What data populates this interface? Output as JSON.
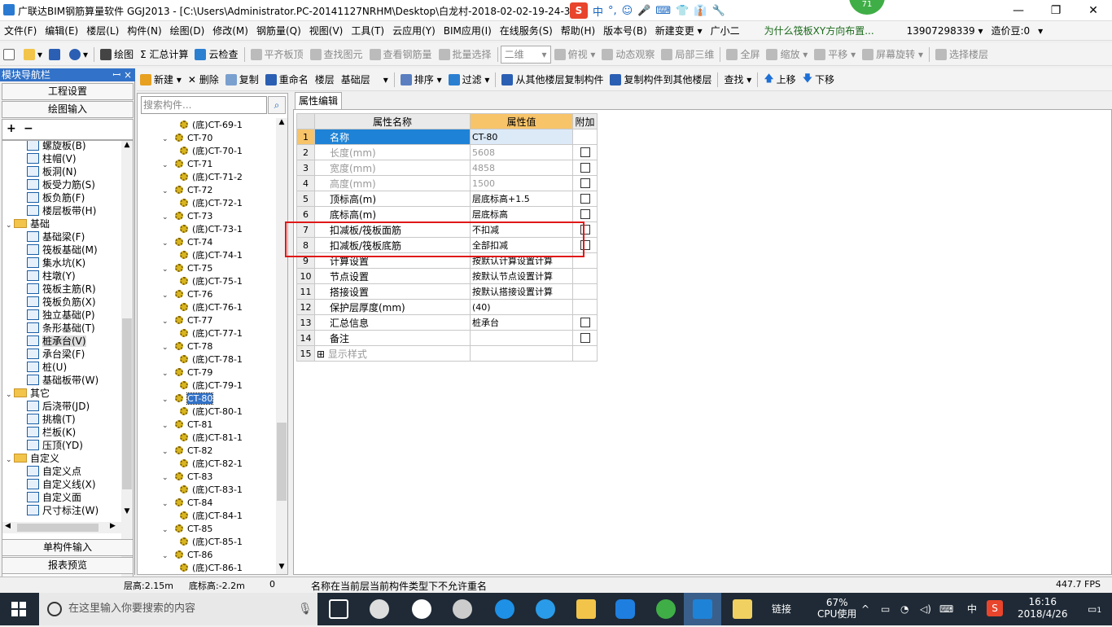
{
  "window": {
    "title": "广联达BIM钢筋算量软件 GGJ2013 - [C:\\Users\\Administrator.PC-20141127NRHM\\Desktop\\白龙村-2018-02-02-19-24-35",
    "minimize": "—",
    "restore": "❐",
    "close": "✕",
    "ime": {
      "logo": "S",
      "lang": "中",
      "items": [
        "°,",
        "☺",
        "🎤",
        "⌨",
        "👕",
        "👔",
        "🔧"
      ]
    },
    "badge": "71"
  },
  "menu": [
    "文件(F)",
    "编辑(E)",
    "楼层(L)",
    "构件(N)",
    "绘图(D)",
    "修改(M)",
    "钢筋量(Q)",
    "视图(V)",
    "工具(T)",
    "云应用(Y)",
    "BIM应用(I)",
    "在线服务(S)",
    "帮助(H)",
    "版本号(B)",
    "新建变更 ▾",
    "广小二",
    "为什么筏板XY方向布置...",
    "13907298339 ▾",
    "造价豆:0",
    "▾"
  ],
  "toolbar1": {
    "items": [
      "绘图",
      "Σ 汇总计算",
      "云检查",
      "平齐板顶",
      "查找图元",
      "查看钢筋量",
      "批量选择"
    ],
    "view_select": "二维",
    "right_items": [
      "俯视 ▾",
      "动态观察",
      "局部三维",
      "全屏",
      "缩放 ▾",
      "平移 ▾",
      "屏幕旋转 ▾",
      "选择楼层"
    ]
  },
  "toolbar2": {
    "items": [
      "新建 ▾",
      "✕ 删除",
      "复制",
      "重命名",
      "楼层",
      "基础层",
      "▾",
      "排序 ▾",
      "过滤 ▾",
      "从其他楼层复制构件",
      "复制构件到其他楼层",
      "查找 ▾",
      "上移",
      "下移"
    ]
  },
  "nav": {
    "header": "模块导航栏",
    "pin": "ꟷ ×",
    "btn_project": "工程设置",
    "btn_draw": "绘图输入",
    "tree": [
      {
        "t": "螺旋板(B)",
        "lvl": 2
      },
      {
        "t": "柱帽(V)",
        "lvl": 2
      },
      {
        "t": "板洞(N)",
        "lvl": 2
      },
      {
        "t": "板受力筋(S)",
        "lvl": 2
      },
      {
        "t": "板负筋(F)",
        "lvl": 2
      },
      {
        "t": "楼层板带(H)",
        "lvl": 2
      },
      {
        "t": "基础",
        "lvl": 1
      },
      {
        "t": "基础梁(F)",
        "lvl": 2
      },
      {
        "t": "筏板基础(M)",
        "lvl": 2
      },
      {
        "t": "集水坑(K)",
        "lvl": 2
      },
      {
        "t": "柱墩(Y)",
        "lvl": 2
      },
      {
        "t": "筏板主筋(R)",
        "lvl": 2
      },
      {
        "t": "筏板负筋(X)",
        "lvl": 2
      },
      {
        "t": "独立基础(P)",
        "lvl": 2
      },
      {
        "t": "条形基础(T)",
        "lvl": 2
      },
      {
        "t": "桩承台(V)",
        "lvl": 2,
        "sel": true
      },
      {
        "t": "承台梁(F)",
        "lvl": 2
      },
      {
        "t": "桩(U)",
        "lvl": 2
      },
      {
        "t": "基础板带(W)",
        "lvl": 2
      },
      {
        "t": "其它",
        "lvl": 1
      },
      {
        "t": "后浇带(JD)",
        "lvl": 2
      },
      {
        "t": "挑檐(T)",
        "lvl": 2
      },
      {
        "t": "栏板(K)",
        "lvl": 2
      },
      {
        "t": "压顶(YD)",
        "lvl": 2
      },
      {
        "t": "自定义",
        "lvl": 1
      },
      {
        "t": "自定义点",
        "lvl": 2
      },
      {
        "t": "自定义线(X)",
        "lvl": 2
      },
      {
        "t": "自定义面",
        "lvl": 2
      },
      {
        "t": "尺寸标注(W)",
        "lvl": 2
      }
    ],
    "btn_single": "单构件输入",
    "btn_report": "报表预览"
  },
  "comp": {
    "search_placeholder": "搜索构件...",
    "rows": [
      {
        "t": "(底)CT-69-1",
        "lvl": 2
      },
      {
        "t": "CT-70",
        "lvl": 1
      },
      {
        "t": "(底)CT-70-1",
        "lvl": 2
      },
      {
        "t": "CT-71",
        "lvl": 1
      },
      {
        "t": "(底)CT-71-2",
        "lvl": 2
      },
      {
        "t": "CT-72",
        "lvl": 1
      },
      {
        "t": "(底)CT-72-1",
        "lvl": 2
      },
      {
        "t": "CT-73",
        "lvl": 1
      },
      {
        "t": "(底)CT-73-1",
        "lvl": 2
      },
      {
        "t": "CT-74",
        "lvl": 1
      },
      {
        "t": "(底)CT-74-1",
        "lvl": 2
      },
      {
        "t": "CT-75",
        "lvl": 1
      },
      {
        "t": "(底)CT-75-1",
        "lvl": 2
      },
      {
        "t": "CT-76",
        "lvl": 1
      },
      {
        "t": "(底)CT-76-1",
        "lvl": 2
      },
      {
        "t": "CT-77",
        "lvl": 1
      },
      {
        "t": "(底)CT-77-1",
        "lvl": 2
      },
      {
        "t": "CT-78",
        "lvl": 1
      },
      {
        "t": "(底)CT-78-1",
        "lvl": 2
      },
      {
        "t": "CT-79",
        "lvl": 1
      },
      {
        "t": "(底)CT-79-1",
        "lvl": 2
      },
      {
        "t": "CT-80",
        "lvl": 1,
        "sel": true
      },
      {
        "t": "(底)CT-80-1",
        "lvl": 2
      },
      {
        "t": "CT-81",
        "lvl": 1
      },
      {
        "t": "(底)CT-81-1",
        "lvl": 2
      },
      {
        "t": "CT-82",
        "lvl": 1
      },
      {
        "t": "(底)CT-82-1",
        "lvl": 2
      },
      {
        "t": "CT-83",
        "lvl": 1
      },
      {
        "t": "(底)CT-83-1",
        "lvl": 2
      },
      {
        "t": "CT-84",
        "lvl": 1
      },
      {
        "t": "(底)CT-84-1",
        "lvl": 2
      },
      {
        "t": "CT-85",
        "lvl": 1
      },
      {
        "t": "(底)CT-85-1",
        "lvl": 2
      },
      {
        "t": "CT-86",
        "lvl": 1
      },
      {
        "t": "(底)CT-86-1",
        "lvl": 2
      }
    ]
  },
  "props": {
    "tab": "属性编辑",
    "headers": {
      "name": "属性名称",
      "value": "属性值",
      "add": "附加"
    },
    "rows": [
      {
        "n": "1",
        "name": "名称",
        "val": "CT-80",
        "cb": false,
        "sel": true
      },
      {
        "n": "2",
        "name": "长度(mm)",
        "val": "5608",
        "cb": true,
        "grey": true
      },
      {
        "n": "3",
        "name": "宽度(mm)",
        "val": "4858",
        "cb": true,
        "grey": true
      },
      {
        "n": "4",
        "name": "高度(mm)",
        "val": "1500",
        "cb": true,
        "grey": true
      },
      {
        "n": "5",
        "name": "顶标高(m)",
        "val": "层底标高+1.5",
        "cb": true
      },
      {
        "n": "6",
        "name": "底标高(m)",
        "val": "层底标高",
        "cb": true
      },
      {
        "n": "7",
        "name": "扣减板/筏板面筋",
        "val": "不扣减",
        "cb": true
      },
      {
        "n": "8",
        "name": "扣减板/筏板底筋",
        "val": "全部扣减",
        "cb": true
      },
      {
        "n": "9",
        "name": "计算设置",
        "val": "按默认计算设置计算",
        "cb": false
      },
      {
        "n": "10",
        "name": "节点设置",
        "val": "按默认节点设置计算",
        "cb": false
      },
      {
        "n": "11",
        "name": "搭接设置",
        "val": "按默认搭接设置计算",
        "cb": false
      },
      {
        "n": "12",
        "name": "保护层厚度(mm)",
        "val": "(40)",
        "cb": false
      },
      {
        "n": "13",
        "name": "汇总信息",
        "val": "桩承台",
        "cb": true
      },
      {
        "n": "14",
        "name": "备注",
        "val": "",
        "cb": true
      },
      {
        "n": "15",
        "name": "显示样式",
        "val": "",
        "cb": false,
        "expand": true
      }
    ]
  },
  "status": {
    "floor_height": "层高:2.15m",
    "floor_bottom": "底标高:-2.2m",
    "zero": "0",
    "message": "名称在当前层当前构件类型下不允许重名",
    "fps": "447.7 FPS"
  },
  "taskbar": {
    "search_placeholder": "在这里输入你要搜索的内容",
    "link": "链接",
    "cpu_pct": "67%",
    "cpu_label": "CPU使用",
    "lang": "中",
    "time": "16:16",
    "date": "2018/4/26",
    "notif": "1"
  }
}
